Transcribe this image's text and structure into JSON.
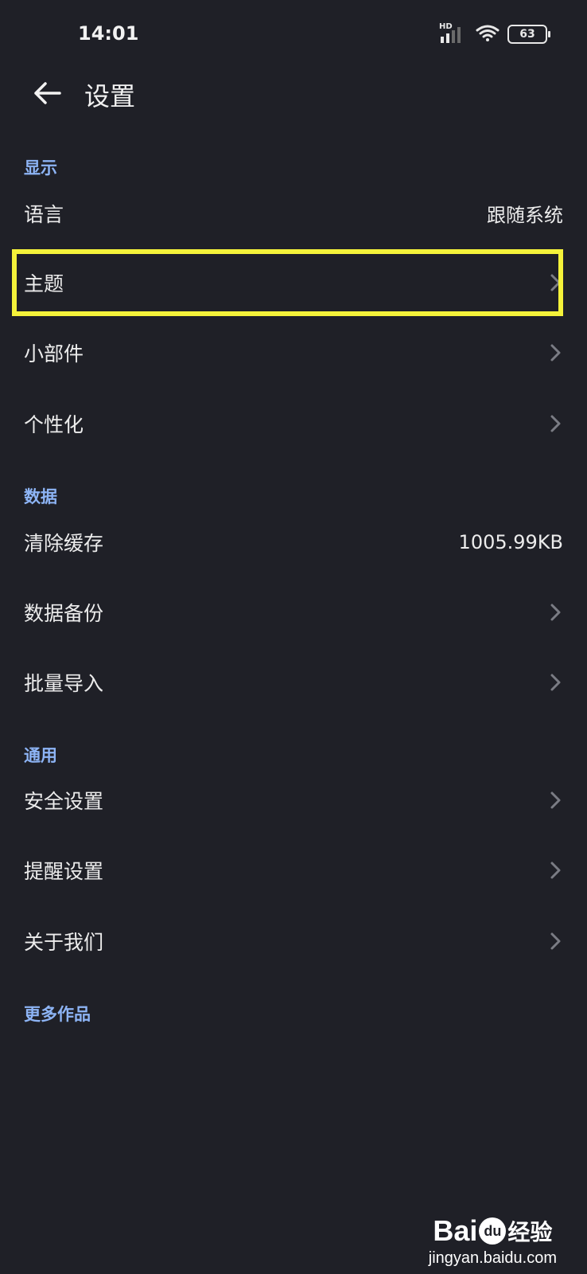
{
  "status_bar": {
    "time": "14:01",
    "battery": "63",
    "network_label": "HD"
  },
  "header": {
    "title": "设置"
  },
  "sections": {
    "display": {
      "label": "显示",
      "items": [
        {
          "label": "语言",
          "value": "跟随系统"
        },
        {
          "label": "主题"
        },
        {
          "label": "小部件"
        },
        {
          "label": "个性化"
        }
      ]
    },
    "data": {
      "label": "数据",
      "items": [
        {
          "label": "清除缓存",
          "value": "1005.99KB"
        },
        {
          "label": "数据备份"
        },
        {
          "label": "批量导入"
        }
      ]
    },
    "general": {
      "label": "通用",
      "items": [
        {
          "label": "安全设置"
        },
        {
          "label": "提醒设置"
        },
        {
          "label": "关于我们"
        }
      ]
    },
    "more": {
      "label": "更多作品"
    }
  },
  "watermark": {
    "logo_left": "Bai",
    "logo_mid": "du",
    "logo_right": "经验",
    "url": "jingyan.baidu.com"
  },
  "colors": {
    "background": "#1f2027",
    "section_label": "#8db4f5",
    "highlight": "#f4f23a",
    "text": "#ececec"
  }
}
